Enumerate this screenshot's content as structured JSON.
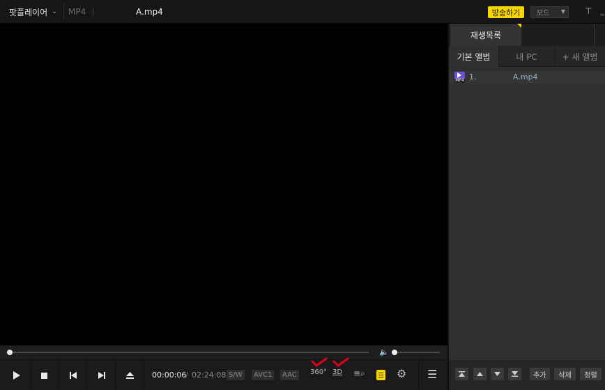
{
  "titlebar": {
    "app_menu": "팟플레이어",
    "format": "MP4",
    "filename": "A.mp4",
    "broadcast": "방송하기",
    "mode": "모드"
  },
  "controls": {
    "time_current": "00:00:06",
    "time_separator": "/",
    "time_total": "02:24:08",
    "badges": [
      "S/W",
      "AVC1",
      "AAC"
    ],
    "label_360": "360°",
    "label_3d": "3D",
    "seek_progress": 0.0
  },
  "panel": {
    "tab_playlist": "재생목록",
    "albums": [
      "기본 앨범",
      "내 PC",
      "+ 새 앨범"
    ],
    "items": [
      {
        "index": "1.",
        "name": "A.mp4",
        "type_label": "MP4"
      }
    ],
    "bottom_buttons": [
      "추가",
      "삭제",
      "정렬"
    ]
  },
  "colors": {
    "accent": "#f5d400",
    "check": "#e0001b",
    "mp4_icon": "#6a4fd6"
  }
}
